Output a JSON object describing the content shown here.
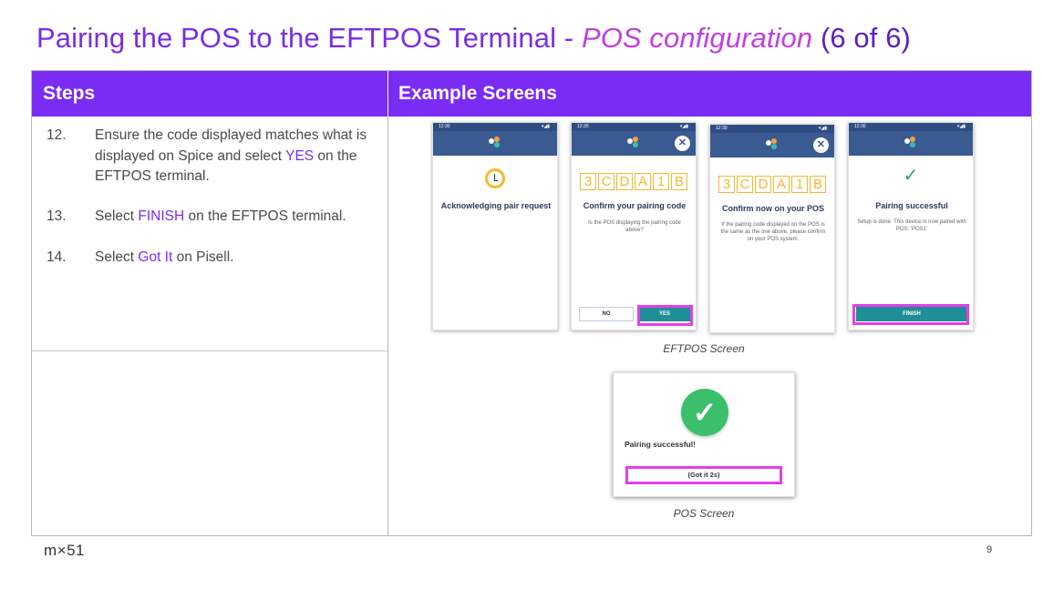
{
  "title": {
    "main": "Pairing the POS to the EFTPOS Terminal - ",
    "sub": "POS configuration",
    "count": " (6 of 6)"
  },
  "table": {
    "steps_header": "Steps",
    "screens_header": "Example Screens"
  },
  "steps": [
    {
      "num": "12.",
      "pre": "Ensure the code displayed matches what is displayed on Spice and select ",
      "highlight": "YES",
      "post": " on the EFTPOS terminal."
    },
    {
      "num": "13.",
      "pre": "Select ",
      "highlight": "FINISH",
      "post": " on the EFTPOS terminal."
    },
    {
      "num": "14.",
      "pre": "Select ",
      "highlight": "Got It",
      "post": " on Pisell."
    }
  ],
  "eftpos_screens": [
    {
      "status_time": "12:30",
      "title": "Acknowledging pair request",
      "icon": "clock-icon"
    },
    {
      "status_time": "12:30",
      "code": [
        "3",
        "C",
        "D",
        "A",
        "1",
        "B"
      ],
      "title": "Confirm your pairing code",
      "body": "Is the POS displaying the pairing code above?",
      "no_label": "NO",
      "yes_label": "YES"
    },
    {
      "status_time": "12:30",
      "code": [
        "3",
        "C",
        "D",
        "A",
        "1",
        "B"
      ],
      "title": "Confirm now on your POS",
      "body": "If the pairing code displayed on the POS is the same as the one above, please confirm on your POS system."
    },
    {
      "status_time": "12:30",
      "title": "Pairing successful",
      "body": "Setup is done. This device is now paired with POS: 'POS1'",
      "finish_label": "FINISH",
      "icon": "checkmark-icon"
    }
  ],
  "captions": {
    "eftpos": "EFTPOS Screen",
    "pos": "POS Screen"
  },
  "pos_screen": {
    "message": "Pairing successful!",
    "button_label": "(Got it 2s)"
  },
  "footer": {
    "brand": "m×51",
    "page_number": "9"
  },
  "colors": {
    "accent": "#7a2cf5",
    "highlight_box": "#e63ee8",
    "terminal_header": "#3a5a92",
    "code_digit": "#f5b82e",
    "success": "#3cbf6a"
  }
}
